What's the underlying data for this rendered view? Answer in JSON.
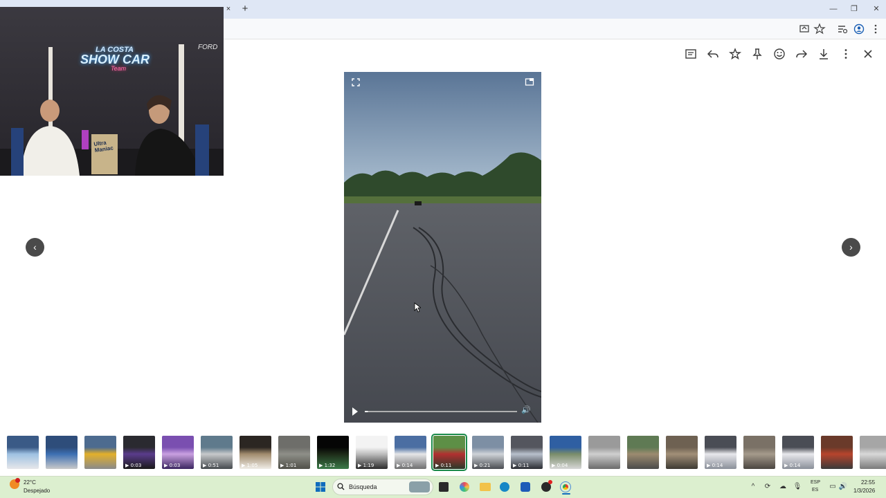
{
  "browser": {
    "tab_close_glyph": "×",
    "new_tab_glyph": "+",
    "minimize_glyph": "—",
    "restore_glyph": "❐",
    "close_glyph": "✕",
    "address_icons": [
      "cast-icon",
      "star-icon",
      "tab-search-icon",
      "profile-icon",
      "menu-icon"
    ]
  },
  "webcam": {
    "neon_line1": "LA COSTA",
    "neon_line2": "SHOW CAR",
    "neon_line3": "Team",
    "corner_text": "FORD",
    "book_text": "Ultra Maniac"
  },
  "viewer": {
    "toolbar_icons": [
      "filter-icon",
      "reply-icon",
      "star-icon",
      "pin-icon",
      "emoji-icon",
      "forward-icon",
      "download-icon",
      "more-icon",
      "close-icon"
    ],
    "prev_glyph": "‹",
    "next_glyph": "›",
    "video": {
      "progress": 0.02,
      "volume_glyph": "🔊"
    }
  },
  "thumbnails": [
    {
      "duration": "",
      "colors": [
        "#3a5a86",
        "#9ec1e2",
        "#e7e7ea"
      ],
      "selected": false
    },
    {
      "duration": "",
      "colors": [
        "#2e4d7a",
        "#3d6fb2",
        "#c9c9c9"
      ],
      "selected": false
    },
    {
      "duration": "",
      "colors": [
        "#4d6b8f",
        "#e3b02a",
        "#8a8a8a"
      ],
      "selected": false
    },
    {
      "duration": "0:03",
      "colors": [
        "#2a2a30",
        "#5a3c8c",
        "#1a1a1a"
      ],
      "selected": false
    },
    {
      "duration": "0:03",
      "colors": [
        "#7a4fb0",
        "#c9a0e0",
        "#3a2560"
      ],
      "selected": false
    },
    {
      "duration": "0:51",
      "colors": [
        "#5f7a8c",
        "#c7c9cb",
        "#454a4e"
      ],
      "selected": false
    },
    {
      "duration": "1:05",
      "colors": [
        "#2b2622",
        "#a18b6d",
        "#f0ede7"
      ],
      "selected": false
    },
    {
      "duration": "1:01",
      "colors": [
        "#6e6e6a",
        "#8e8f88",
        "#505049"
      ],
      "selected": false
    },
    {
      "duration": "1:32",
      "colors": [
        "#050505",
        "#1d2a18",
        "#3a7a48"
      ],
      "selected": false
    },
    {
      "duration": "1:19",
      "colors": [
        "#f3f3f3",
        "#bdbdbd",
        "#2b2b2b"
      ],
      "selected": false
    },
    {
      "duration": "0:14",
      "colors": [
        "#4b6ea2",
        "#e5e6e8",
        "#6f6f70"
      ],
      "selected": false
    },
    {
      "duration": "0:11",
      "colors": [
        "#5d8f46",
        "#b13030",
        "#2a3a2a"
      ],
      "selected": true
    },
    {
      "duration": "0:21",
      "colors": [
        "#7d8fa4",
        "#cfd3d8",
        "#4a4d52"
      ],
      "selected": false
    },
    {
      "duration": "0:11",
      "colors": [
        "#54565e",
        "#b8c0cc",
        "#2b2d33"
      ],
      "selected": false
    },
    {
      "duration": "0:04",
      "colors": [
        "#2f5fa2",
        "#7a8d6a",
        "#d7d7d7"
      ],
      "selected": false
    },
    {
      "duration": "",
      "colors": [
        "#9a9a9a",
        "#cfcfcf",
        "#6b6b6b"
      ],
      "selected": false
    },
    {
      "duration": "",
      "colors": [
        "#5f7a54",
        "#9c8b70",
        "#4a4a4a"
      ],
      "selected": false
    },
    {
      "duration": "",
      "colors": [
        "#6e6152",
        "#a28f78",
        "#3e3a33"
      ],
      "selected": false
    },
    {
      "duration": "0:14",
      "colors": [
        "#4a4d55",
        "#e8e8ec",
        "#8a8f99"
      ],
      "selected": false
    },
    {
      "duration": "",
      "colors": [
        "#7a7166",
        "#a59a8b",
        "#4a4540"
      ],
      "selected": false
    },
    {
      "duration": "0:14",
      "colors": [
        "#4a4d55",
        "#e8e8ec",
        "#8a8f99"
      ],
      "selected": false
    },
    {
      "duration": "",
      "colors": [
        "#6a3a2a",
        "#b7442c",
        "#3a3a3a"
      ],
      "selected": false
    },
    {
      "duration": "",
      "colors": [
        "#a6a6a6",
        "#d8d8d8",
        "#7a7a7a"
      ],
      "selected": false
    }
  ],
  "taskbar": {
    "weather_temp": "22°C",
    "weather_desc": "Despejado",
    "search_placeholder": "Búsqueda",
    "lang_line1": "ESP",
    "lang_line2": "ES",
    "time": "22:55",
    "date": "1/3/2026",
    "accent": "#0f6cbd"
  }
}
